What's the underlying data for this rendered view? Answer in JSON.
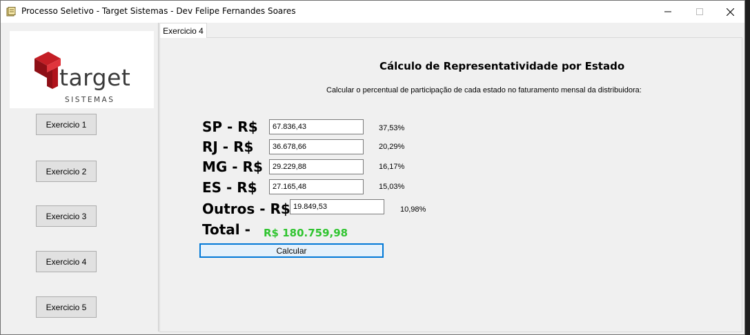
{
  "window": {
    "title": "Processo Seletivo - Target Sistemas - Dev Felipe Fernandes Soares",
    "controls": {
      "minimize_icon": "minimize-icon",
      "maximize_icon": "maximize-icon",
      "close_icon": "close-icon"
    }
  },
  "logo": {
    "word": "target",
    "sub": "SISTEMAS",
    "brand_color": "#b0121b"
  },
  "sidebar": {
    "buttons": [
      {
        "label": "Exercicio 1"
      },
      {
        "label": "Exercicio 2"
      },
      {
        "label": "Exercicio 3"
      },
      {
        "label": "Exercicio 4"
      },
      {
        "label": "Exercicio 5"
      }
    ]
  },
  "tab": {
    "label": "Exercicio 4"
  },
  "main": {
    "heading": "Cálculo de Representatividade por Estado",
    "subheading": "Calcular o percentual de participação de cada estado no faturamento mensal da distribuidora:",
    "states": [
      {
        "label": "SP - R$",
        "value": "67.836,43",
        "percent": "37,53%"
      },
      {
        "label": "RJ - R$",
        "value": "36.678,66",
        "percent": "20,29%"
      },
      {
        "label": "MG - R$",
        "value": "29.229,88",
        "percent": "16,17%"
      },
      {
        "label": "ES - R$",
        "value": "27.165,48",
        "percent": "15,03%"
      },
      {
        "label": "Outros - R$",
        "value": "19.849,53",
        "percent": "10,98%"
      }
    ],
    "total_label": "Total -",
    "total_value": "R$ 180.759,98",
    "total_color": "#2fc42f",
    "calc_button": "Calcular"
  }
}
